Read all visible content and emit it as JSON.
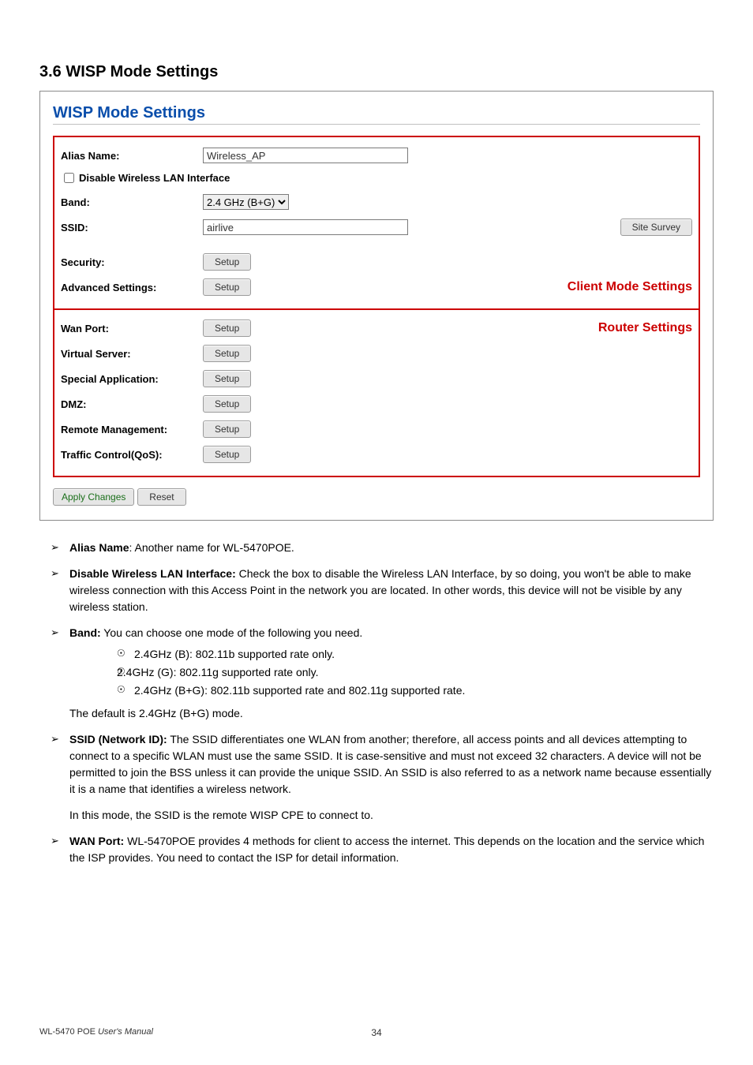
{
  "section_heading": "3.6 WISP Mode Settings",
  "panel": {
    "title": "WISP Mode Settings",
    "alias_label": "Alias Name:",
    "alias_value": "Wireless_AP",
    "disable_checkbox_label": "Disable Wireless LAN Interface",
    "band_label": "Band:",
    "band_value": "2.4 GHz (B+G)",
    "ssid_label": "SSID:",
    "ssid_value": "airlive",
    "site_survey_btn": "Site Survey",
    "security_label": "Security:",
    "advanced_label": "Advanced Settings:",
    "wan_label": "Wan Port:",
    "virtual_label": "Virtual Server:",
    "special_label": "Special Application:",
    "dmz_label": "DMZ:",
    "remote_label": "Remote Management:",
    "qos_label": "Traffic Control(QoS):",
    "setup_btn": "Setup",
    "annot_client": "Client Mode Settings",
    "annot_router": "Router Settings",
    "apply_btn": "Apply Changes",
    "reset_btn": "Reset"
  },
  "bullets": {
    "alias": {
      "bold": "Alias Name",
      "text": ": Another name for WL-5470POE."
    },
    "disable": {
      "bold": "Disable Wireless LAN Interface:",
      "text": " Check the box to disable the Wireless LAN Interface, by so doing, you won't be able to make wireless connection with this Access Point in the network you are located. In other words, this device will not be visible by any wireless station."
    },
    "band": {
      "bold": "Band:",
      "text": " You can choose one mode of the following you need."
    },
    "band_opts": [
      "2.4GHz (B): 802.11b supported rate only.",
      "2.4GHz (G): 802.11g supported rate only.",
      "2.4GHz (B+G): 802.11b supported rate and 802.11g supported rate."
    ],
    "band_default": "The default is 2.4GHz (B+G) mode.",
    "ssid": {
      "bold": "SSID (Network ID):",
      "text": " The SSID differentiates one WLAN from another; therefore, all access points and all devices attempting to connect to a specific WLAN must use the same SSID. It is case-sensitive and must not exceed 32 characters. A device will not be permitted to join the BSS unless it can provide the unique SSID. An SSID is also referred to as a network name because essentially it is a name that identifies a wireless network."
    },
    "ssid_note": "In this mode, the SSID is the remote WISP CPE to connect to.",
    "wan": {
      "bold": "WAN Port:",
      "text": " WL-5470POE provides 4 methods for client to access the internet. This depends on the location and the service which the ISP provides. You need to contact the ISP for detail information."
    }
  },
  "footer": {
    "left_prefix": "WL-5470 POE ",
    "left_italic": "User's Manual",
    "page": "34"
  }
}
